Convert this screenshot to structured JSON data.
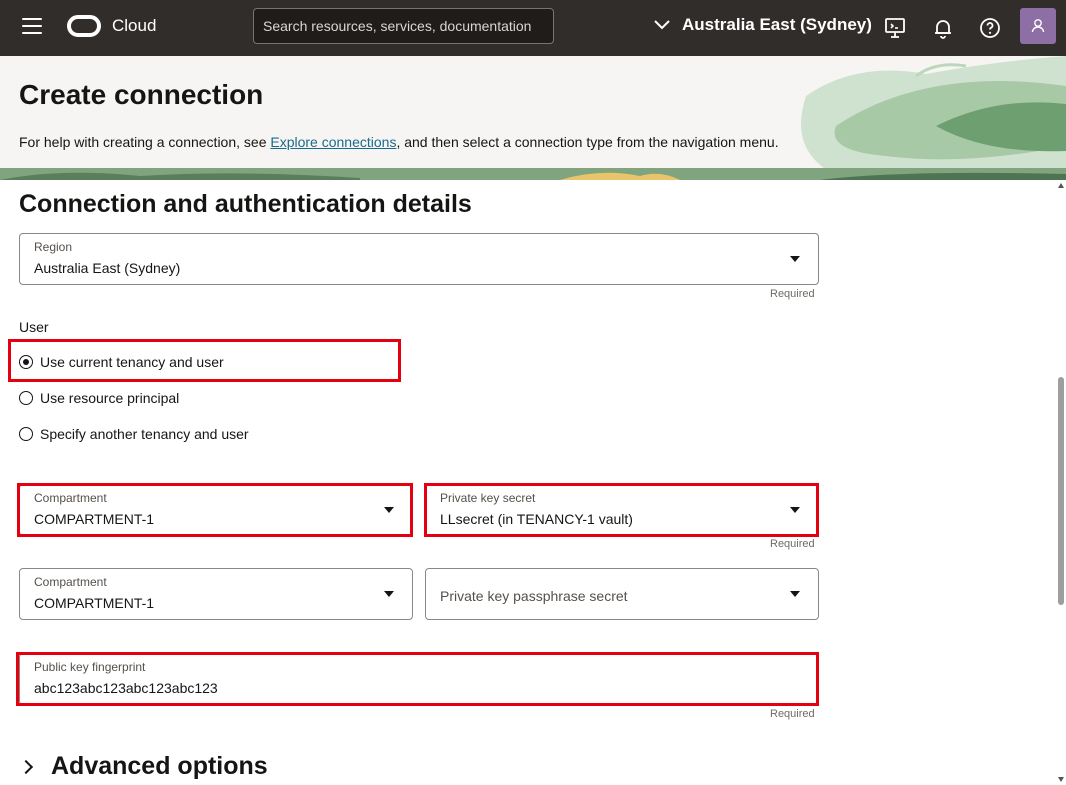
{
  "topbar": {
    "brand": "Cloud",
    "search_placeholder": "Search resources, services, documentation",
    "region": "Australia East (Sydney)"
  },
  "header": {
    "title": "Create connection",
    "help_prefix": "For help with creating a connection, see ",
    "help_link": "Explore connections",
    "help_suffix": ", and then select a connection type from the navigation menu."
  },
  "form": {
    "section_title": "Connection and authentication details",
    "region_field": {
      "label": "Region",
      "value": "Australia East (Sydney)",
      "required": "Required"
    },
    "user_label": "User",
    "user_options": [
      {
        "label": "Use current tenancy and user",
        "checked": true
      },
      {
        "label": "Use resource principal",
        "checked": false
      },
      {
        "label": "Specify another tenancy and user",
        "checked": false
      }
    ],
    "private_key_compartment": {
      "label": "Compartment",
      "value": "COMPARTMENT-1"
    },
    "private_key_secret": {
      "label": "Private key secret",
      "value": "LLsecret (in TENANCY-1 vault)",
      "required": "Required"
    },
    "passphrase_compartment": {
      "label": "Compartment",
      "value": "COMPARTMENT-1"
    },
    "passphrase_secret": {
      "placeholder": "Private key passphrase secret"
    },
    "fingerprint": {
      "label": "Public key fingerprint",
      "value": "abc123abc123abc123abc123",
      "required": "Required"
    },
    "advanced_options": "Advanced options"
  },
  "colors": {
    "topbar": "#312d2a",
    "highlight": "#e5000f",
    "link": "#1a6a8a",
    "header_bg": "#f7f5f3"
  }
}
